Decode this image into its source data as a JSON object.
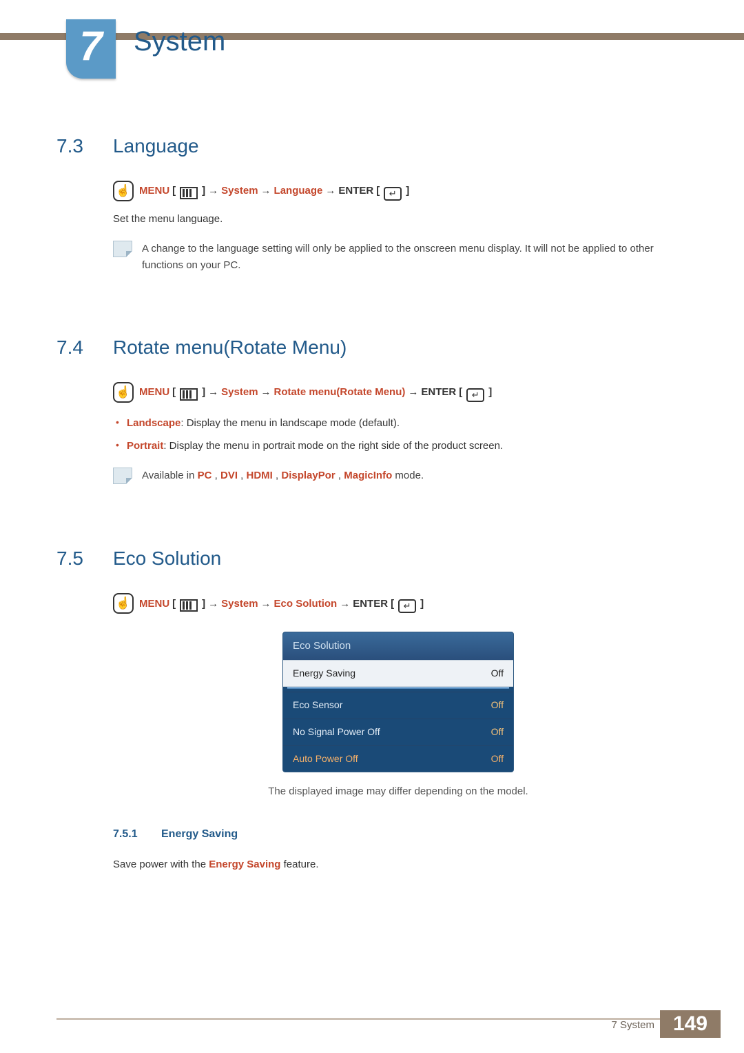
{
  "chapter": {
    "number": "7",
    "title": "System"
  },
  "sections": {
    "s73": {
      "num": "7.3",
      "title": "Language",
      "menu_label": "MENU",
      "path_system": "System",
      "path_item": "Language",
      "enter_label": "ENTER",
      "intro": "Set the menu language.",
      "note": "A change to the language setting will only be applied to the onscreen menu display. It will not be applied to other functions on your PC."
    },
    "s74": {
      "num": "7.4",
      "title": "Rotate menu(Rotate Menu)",
      "menu_label": "MENU",
      "path_system": "System",
      "path_item": "Rotate menu(Rotate Menu)",
      "enter_label": "ENTER",
      "landscape_label": "Landscape",
      "landscape_text": ": Display the menu in landscape mode (default).",
      "portrait_label": "Portrait",
      "portrait_text": ": Display the menu in portrait mode on the right side of the product screen.",
      "note_prefix": "Available in ",
      "modes": [
        "PC",
        "DVI",
        "HDMI",
        "DisplayPor",
        "MagicInfo"
      ],
      "note_suffix": " mode."
    },
    "s75": {
      "num": "7.5",
      "title": "Eco Solution",
      "menu_label": "MENU",
      "path_system": "System",
      "path_item": "Eco Solution",
      "enter_label": "ENTER",
      "osd": {
        "title": "Eco Solution",
        "selected": {
          "label": "Energy Saving",
          "value": "Off"
        },
        "rows": [
          {
            "label": "Eco Sensor",
            "value": "Off"
          },
          {
            "label": "No Signal Power Off",
            "value": "Off"
          },
          {
            "label": "Auto Power Off",
            "value": "Off"
          }
        ]
      },
      "caption": "The displayed image may differ depending on the model.",
      "sub": {
        "num": "7.5.1",
        "title": "Energy Saving",
        "text_before": "Save power with the ",
        "text_key": "Energy Saving",
        "text_after": " feature."
      }
    }
  },
  "footer": {
    "label": "7 System",
    "page": "149"
  }
}
